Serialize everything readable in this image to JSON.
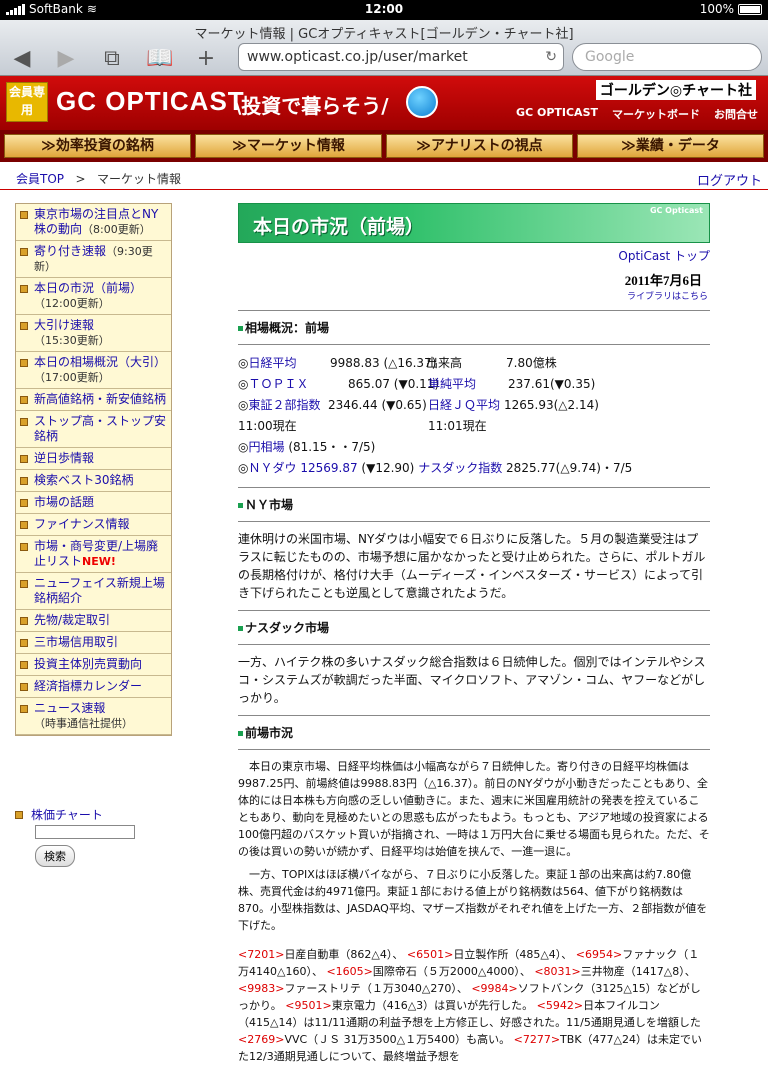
{
  "status": {
    "carrier": "SoftBank",
    "time": "12:00",
    "battery": "100%"
  },
  "browser": {
    "page_title": "マーケット情報 | GCオプティキャスト[ゴールデン・チャート社]",
    "url": "www.opticast.co.jp/user/market",
    "search_placeholder": "Google"
  },
  "site": {
    "member_badge": "会員専用",
    "logo": "GC OPTICAST",
    "catch": "\\投資で暮らそう/",
    "brand": "ゴールデン◎チャート社",
    "top_links": [
      "GC OPTICAST",
      "マーケットボード",
      "お問合せ"
    ],
    "nav": [
      "効率投資の銘柄",
      "マーケット情報",
      "アナリストの視点",
      "業績・データ"
    ]
  },
  "breadcrumb": {
    "home": "会員TOP",
    "sep": ">",
    "current": "マーケット情報",
    "logout": "ログアウト"
  },
  "sidebar": [
    {
      "label": "東京市場の注目点とNY株の動向",
      "sub": "（8:00更新）"
    },
    {
      "label": "寄り付き速報",
      "sub": "（9:30更新）"
    },
    {
      "label": "本日の市況（前場）",
      "sub": "（12:00更新）"
    },
    {
      "label": "大引け速報",
      "sub": "（15:30更新）"
    },
    {
      "label": "本日の相場概況（大引）",
      "sub": "（17:00更新）"
    },
    {
      "label": "新高値銘柄・新安値銘柄",
      "sub": ""
    },
    {
      "label": "ストップ高・ストップ安銘柄",
      "sub": ""
    },
    {
      "label": "逆日歩情報",
      "sub": ""
    },
    {
      "label": "検索ベスト30銘柄",
      "sub": ""
    },
    {
      "label": "市場の話題",
      "sub": ""
    },
    {
      "label": "ファイナンス情報",
      "sub": ""
    },
    {
      "label": "市場・商号変更/上場廃止リスト",
      "sub": "",
      "badge": "NEW!"
    },
    {
      "label": "ニューフェイス新規上場銘柄紹介",
      "sub": ""
    },
    {
      "label": "先物/裁定取引",
      "sub": ""
    },
    {
      "label": "三市場信用取引",
      "sub": ""
    },
    {
      "label": "投資主体別売買動向",
      "sub": ""
    },
    {
      "label": "経済指標カレンダー",
      "sub": ""
    },
    {
      "label": "ニュース速報",
      "sub": "（時事通信社提供）"
    }
  ],
  "chart_search": {
    "label": "株価チャート",
    "button": "検索"
  },
  "main": {
    "banner_title": "本日の市況（前場）",
    "banner_brand": "GC Opticast",
    "opticast_top": "OptiCast トップ",
    "date": "2011年7月6日",
    "library": "ライブラリはこちら",
    "s1": "相場概況：前場",
    "market": {
      "nikkei_label": "日経平均",
      "nikkei_val": "9988.83 (△16.37)",
      "volume_label": "出来高",
      "volume_val": "7.80億株",
      "topix_label": "ＴＯＰＩＸ",
      "topix_val": "865.07 (▼0.11)",
      "simple_label": "単純平均",
      "simple_val": "237.61(▼0.35)",
      "tse2_label": "東証２部指数",
      "tse2_val": "2346.44 (▼0.65)",
      "jq_label": "日経ＪＱ平均",
      "jq_val": "1265.93(△2.14)",
      "now1": "11:00現在",
      "now2": "11:01現在",
      "yen_label": "円相場",
      "yen_val": "(81.15・・7/5)",
      "dow_label": "ＮＹダウ",
      "dow_num": "12569.87",
      "dow_val": "(▼12.90)",
      "nasdaq_label": "ナスダック指数",
      "nasdaq_val": "2825.77(△9.74)・7/5",
      "mark": "◎"
    },
    "s2": "ＮＹ市場",
    "ny_text": "連休明けの米国市場、NYダウは小幅安で６日ぶりに反落した。５月の製造業受注はプラスに転じたものの、市場予想に届かなかったと受け止められた。さらに、ポルトガルの長期格付けが、格付け大手（ムーディーズ・インベスターズ・サービス）によって引き下げられたことも逆風として意識されたようだ。",
    "s3": "ナスダック市場",
    "nasdaq_text": "一方、ハイテク株の多いナスダック総合指数は６日続伸した。個別ではインテルやシスコ・システムズが軟調だった半面、マイクロソフト、アマゾン・コム、ヤフーなどがしっかり。",
    "s4": "前場市況",
    "zenba1": "本日の東京市場、日経平均株価は小幅高ながら７日続伸した。寄り付きの日経平均株価は9987.25円、前場終値は9988.83円（△16.37）。前日のNYダウが小動きだったこともあり、全体的には日本株も方向感の乏しい値動きに。また、週末に米国雇用統計の発表を控えていることもあり、動向を見極めたいとの思惑も広がったもよう。もっとも、アジア地域の投資家による100億円超のバスケット買いが指摘され、一時は１万円大台に乗せる場面も見られた。ただ、その後は買いの勢いが続かず、日経平均は始値を挟んで、一進一退に。",
    "zenba2": "一方、TOPIXはほぼ横バイながら、７日ぶりに小反落した。東証１部の出来高は約7.80億株、売買代金は約4971億円。東証１部における値上がり銘柄数は564、値下がり銘柄数は870。小型株指数は、JASDAQ平均、マザーズ指数がそれぞれ値を上げた一方、２部指数が値を下げた。",
    "stocks": [
      {
        "code": "<7201>",
        "text": "日産自動車（862△4）、"
      },
      {
        "code": "<6501>",
        "text": "日立製作所（485△4）、"
      },
      {
        "code": "<6954>",
        "text": "ファナック（１万4140△160）、"
      },
      {
        "code": "<1605>",
        "text": "国際帝石（５万2000△4000）、"
      },
      {
        "code": "<8031>",
        "text": "三井物産（1417△8）、"
      },
      {
        "code": "<9983>",
        "text": "ファーストリテ（１万3040△270）、"
      },
      {
        "code": "<9984>",
        "text": "ソフトバンク（3125△15）などがしっかり。"
      },
      {
        "code": "<9501>",
        "text": "東京電力（416△3）は買いが先行した。"
      },
      {
        "code": "<5942>",
        "text": "日本フイルコン（415△14）は11/11通期の利益予想を上方修正し、好感された。11/5通期見通しを増額した"
      },
      {
        "code": "<2769>",
        "text": "VVC（ＪＳ 31万3500△１万5400）も高い。"
      },
      {
        "code": "<7277>",
        "text": "TBK（477△24）は未定でいた12/3通期見通しについて、最終増益予想を"
      }
    ]
  }
}
